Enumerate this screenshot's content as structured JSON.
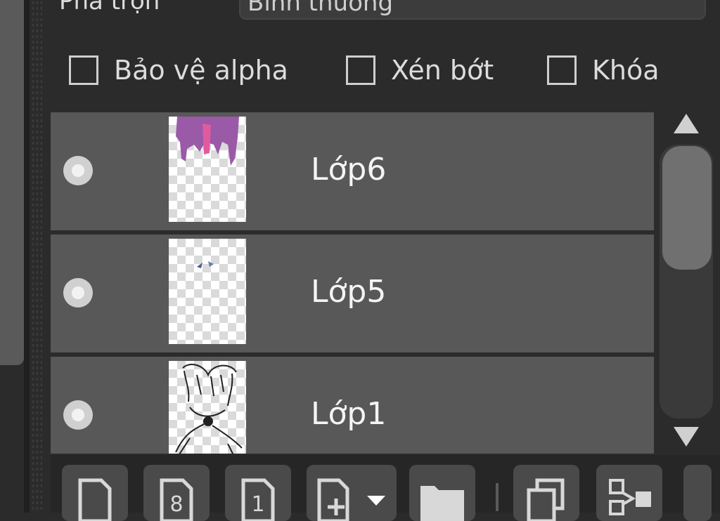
{
  "blend": {
    "label": "Pha trộn",
    "value": "Bình thường"
  },
  "checkboxes": [
    {
      "label": "Bảo vệ alpha",
      "checked": false
    },
    {
      "label": "Xén bớt",
      "checked": false
    },
    {
      "label": "Khóa",
      "checked": false
    }
  ],
  "layers": [
    {
      "name": "Lớp6",
      "visible": true
    },
    {
      "name": "Lớp5",
      "visible": true
    },
    {
      "name": "Lớp1",
      "visible": true
    }
  ],
  "toolbar": {
    "buttons": [
      {
        "icon": "new-layer-icon"
      },
      {
        "icon": "new-8bit-layer-icon",
        "badge": "8"
      },
      {
        "icon": "new-1bit-layer-icon",
        "badge": "1"
      },
      {
        "icon": "add-layer-dropdown-icon"
      },
      {
        "icon": "new-folder-icon"
      },
      {
        "icon": "duplicate-layer-icon"
      },
      {
        "icon": "transfer-layer-icon"
      }
    ]
  },
  "colors": {
    "panel": "#2b2b2b",
    "row": "#585858",
    "text": "#f4f4f4",
    "paint_purple": "#9a5aa8",
    "paint_pink": "#e05aa0"
  }
}
